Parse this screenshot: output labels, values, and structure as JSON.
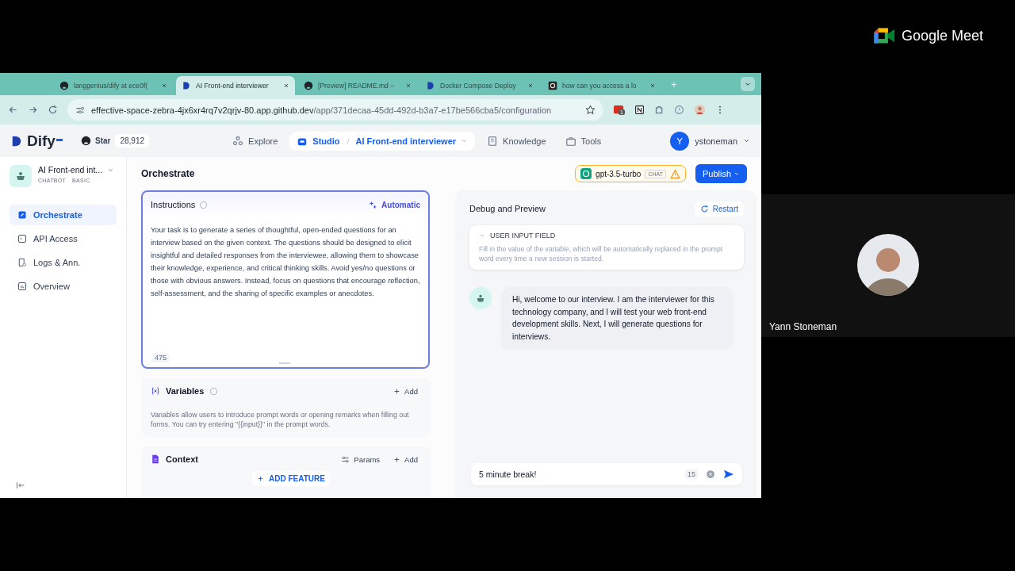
{
  "browser": {
    "tabs": [
      {
        "title": "langgenius/dify at ece0f(",
        "kind": "github",
        "selected": false
      },
      {
        "title": "AI Front-end interviewer",
        "kind": "dify",
        "selected": true
      },
      {
        "title": "[Preview] README.md –",
        "kind": "github",
        "selected": false
      },
      {
        "title": "Docker Compose Deploy",
        "kind": "dify",
        "selected": false
      },
      {
        "title": "how can you access a lo",
        "kind": "chip",
        "selected": false
      }
    ],
    "new_tab": "+",
    "address": {
      "host": "effective-space-zebra-4jx6xr4rq7v2qrjv-80.app.github.dev",
      "path": "/app/371decaa-45dd-492d-b3a7-e17be566cba5/configuration"
    },
    "extension_badge": "1"
  },
  "app": {
    "logo": "Dify",
    "star": {
      "label": "Star",
      "count": "28,912"
    },
    "nav": [
      {
        "label": "Explore",
        "kind": "explore",
        "selected": false
      },
      {
        "label": "Studio",
        "kind": "studio",
        "selected": true,
        "app_name": "AI Front-end interviewer"
      },
      {
        "label": "Knowledge",
        "kind": "knowledge",
        "selected": false
      },
      {
        "label": "Tools",
        "kind": "tools",
        "selected": false
      }
    ],
    "user": {
      "initial": "Y",
      "name": "ystoneman"
    }
  },
  "sidebar": {
    "app": {
      "name": "AI Front-end int...",
      "tags": [
        "CHATBOT",
        "BASIC"
      ]
    },
    "items": [
      {
        "label": "Orchestrate",
        "kind": "orchestrate",
        "selected": true
      },
      {
        "label": "API Access",
        "kind": "api",
        "selected": false
      },
      {
        "label": "Logs & Ann.",
        "kind": "logs",
        "selected": false
      },
      {
        "label": "Overview",
        "kind": "overview",
        "selected": false
      }
    ]
  },
  "orchestrate": {
    "title": "Orchestrate",
    "model": {
      "name": "gpt-3.5-turbo",
      "mode": "CHAT"
    },
    "publish": "Publish",
    "instructions": {
      "title": "Instructions",
      "automatic": "Automatic",
      "text": "Your task is to generate a series of thoughtful, open-ended questions for an interview based on the given context. The questions should be designed to elicit insightful and detailed responses from the interviewee, allowing them to showcase their knowledge, experience, and critical thinking skills. Avoid yes/no questions or those with obvious answers. Instead, focus on questions that encourage reflection, self-assessment, and the sharing of specific examples or anecdotes.",
      "count": "475"
    },
    "variables": {
      "title": "Variables",
      "add": "Add",
      "description": "Variables allow users to introduce prompt words or opening remarks when filling out forms. You can try entering \"{{input}}\" in the prompt words."
    },
    "context": {
      "title": "Context",
      "params": "Params",
      "add": "Add"
    },
    "add_feature": "ADD FEATURE"
  },
  "debug": {
    "title": "Debug and Preview",
    "restart": "Restart",
    "user_input": {
      "title": "USER INPUT FIELD",
      "description": "Fill in the value of the variable, which will be automatically replaced in the prompt word every time a new session is started."
    },
    "messages": [
      {
        "text": "Hi, welcome to our interview. I am the interviewer for this technology company, and I will test your web front-end development skills. Next, I will generate questions for interviews."
      }
    ],
    "input": {
      "value": "5 minute break!",
      "count": "15"
    }
  },
  "meet": {
    "logo_text": "Google Meet",
    "participant": {
      "name": "Yann Stoneman"
    }
  }
}
